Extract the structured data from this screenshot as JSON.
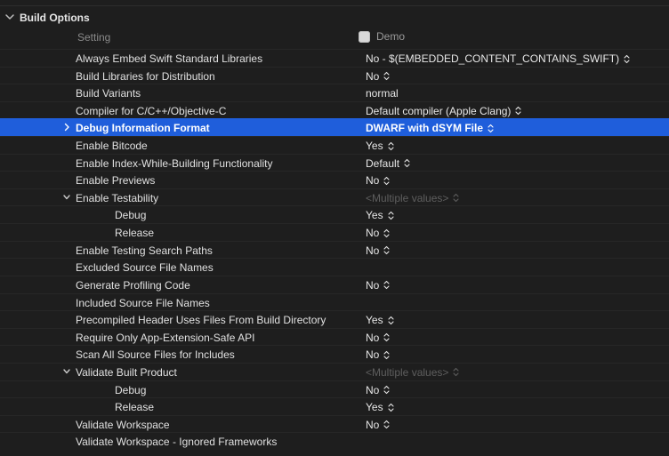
{
  "section": {
    "title": "Build Options"
  },
  "columns": {
    "setting": "Setting",
    "target": "Demo"
  },
  "rows": [
    {
      "name": "Always Embed Swift Standard Libraries",
      "value": "No  -  $(EMBEDDED_CONTENT_CONTAINS_SWIFT)",
      "stepper": true,
      "expand": "none",
      "level": 0
    },
    {
      "name": "Build Libraries for Distribution",
      "value": "No",
      "stepper": true,
      "expand": "none",
      "level": 0
    },
    {
      "name": "Build Variants",
      "value": "normal",
      "stepper": false,
      "expand": "none",
      "level": 0
    },
    {
      "name": "Compiler for C/C++/Objective-C",
      "value": "Default compiler (Apple Clang)",
      "stepper": true,
      "expand": "none",
      "level": 0
    },
    {
      "name": "Debug Information Format",
      "value": "DWARF with dSYM File",
      "stepper": true,
      "expand": "collapsed",
      "level": 0,
      "selected": true
    },
    {
      "name": "Enable Bitcode",
      "value": "Yes",
      "stepper": true,
      "expand": "none",
      "level": 0
    },
    {
      "name": "Enable Index-While-Building Functionality",
      "value": "Default",
      "stepper": true,
      "expand": "none",
      "level": 0
    },
    {
      "name": "Enable Previews",
      "value": "No",
      "stepper": true,
      "expand": "none",
      "level": 0
    },
    {
      "name": "Enable Testability",
      "value": "<Multiple values>",
      "stepper": true,
      "expand": "expanded",
      "level": 0,
      "muted": true
    },
    {
      "name": "Debug",
      "value": "Yes",
      "stepper": true,
      "expand": "none",
      "level": 1
    },
    {
      "name": "Release",
      "value": "No",
      "stepper": true,
      "expand": "none",
      "level": 1
    },
    {
      "name": "Enable Testing Search Paths",
      "value": "No",
      "stepper": true,
      "expand": "none",
      "level": 0
    },
    {
      "name": "Excluded Source File Names",
      "value": "",
      "stepper": false,
      "expand": "none",
      "level": 0
    },
    {
      "name": "Generate Profiling Code",
      "value": "No",
      "stepper": true,
      "expand": "none",
      "level": 0
    },
    {
      "name": "Included Source File Names",
      "value": "",
      "stepper": false,
      "expand": "none",
      "level": 0
    },
    {
      "name": "Precompiled Header Uses Files From Build Directory",
      "value": "Yes",
      "stepper": true,
      "expand": "none",
      "level": 0
    },
    {
      "name": "Require Only App-Extension-Safe API",
      "value": "No",
      "stepper": true,
      "expand": "none",
      "level": 0
    },
    {
      "name": "Scan All Source Files for Includes",
      "value": "No",
      "stepper": true,
      "expand": "none",
      "level": 0
    },
    {
      "name": "Validate Built Product",
      "value": "<Multiple values>",
      "stepper": true,
      "expand": "expanded",
      "level": 0,
      "muted": true
    },
    {
      "name": "Debug",
      "value": "No",
      "stepper": true,
      "expand": "none",
      "level": 1
    },
    {
      "name": "Release",
      "value": "Yes",
      "stepper": true,
      "expand": "none",
      "level": 1
    },
    {
      "name": "Validate Workspace",
      "value": "No",
      "stepper": true,
      "expand": "none",
      "level": 0
    },
    {
      "name": "Validate Workspace - Ignored Frameworks",
      "value": "",
      "stepper": false,
      "expand": "none",
      "level": 0
    }
  ],
  "icons": {
    "section_chevron": "chevron-down-icon",
    "app": "app-icon",
    "stepper": "stepper-icon",
    "expanded": "chevron-down-icon",
    "collapsed": "chevron-right-icon"
  },
  "colors": {
    "selection": "#1f5edb",
    "background": "#1e1e1e"
  }
}
